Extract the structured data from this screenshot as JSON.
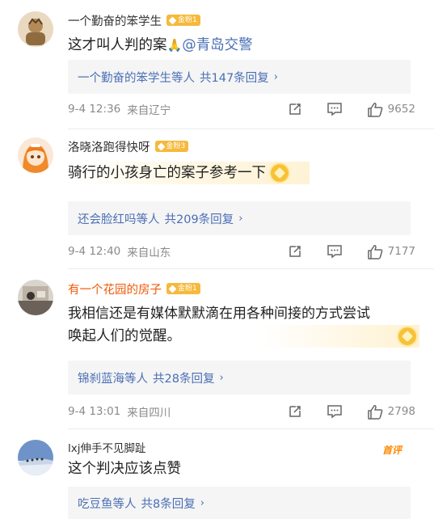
{
  "comments": [
    {
      "username": "一个勤奋的笨学生",
      "fan_badge": "金粉1",
      "text": "这才叫人判的案",
      "emoji": "🙏",
      "mention": "@青岛交警",
      "reply_summary_user": "一个勤奋的笨学生等人",
      "reply_summary_count": "共147条回复",
      "date": "9-4 12:36",
      "location": "来自辽宁",
      "likes": "9652"
    },
    {
      "username": "洛晓洛跑得快呀",
      "fan_badge": "金粉3",
      "text": "骑行的小孩身亡的案子参考一下",
      "reply_summary_user": "还会脸红吗等人",
      "reply_summary_count": "共209条回复",
      "date": "9-4 12:40",
      "location": "来自山东",
      "likes": "7177"
    },
    {
      "username": "有一个花园的房子",
      "fan_badge": "金粉1",
      "text_line1": "我相信还是有媒体默默滴在用各种间接的方式尝试",
      "text_line2": "唤起人们的觉醒。",
      "reply_summary_user": "锦刹蓝海等人",
      "reply_summary_count": "共28条回复",
      "date": "9-4 13:01",
      "location": "来自四川",
      "likes": "2798"
    },
    {
      "username": "lxj伸手不见脚趾",
      "first_label": "首评",
      "text": "这个判决应该点赞",
      "reply_summary_user": "吃豆鱼等人",
      "reply_summary_count": "共8条回复"
    }
  ],
  "colors": {
    "link": "#4a6fb5",
    "orange_name": "#f05a0a",
    "badge": "#f6b93b",
    "meta": "#8a8a8a"
  },
  "icons": [
    "repost-icon",
    "comment-icon",
    "like-icon",
    "chevron-right-icon",
    "medal-icon"
  ]
}
